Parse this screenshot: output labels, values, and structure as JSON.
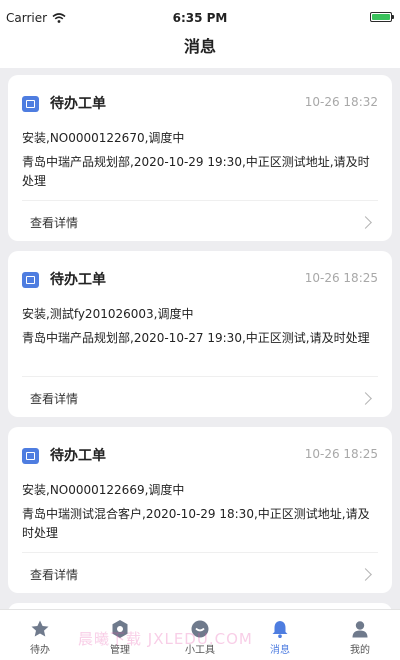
{
  "status_bar": {
    "carrier": "Carrier",
    "time": "6:35 PM"
  },
  "header": {
    "title": "消息"
  },
  "messages": [
    {
      "title": "待办工单",
      "time": "10-26 18:32",
      "line1": "安装,NO0000122670,调度中",
      "line2": "青岛中瑞产品规划部,2020-10-29 19:30,中正区测试地址,请及时处理",
      "action": "查看详情"
    },
    {
      "title": "待办工单",
      "time": "10-26 18:25",
      "line1": "安装,测試fy201026003,调度中",
      "line2": "青岛中瑞产品规划部,2020-10-27 19:30,中正区测试,请及时处理",
      "action": "查看详情"
    },
    {
      "title": "待办工单",
      "time": "10-26 18:25",
      "line1": "安装,NO0000122669,调度中",
      "line2": "青岛中瑞测试混合客户,2020-10-29 18:30,中正区测试地址,请及时处理",
      "action": "查看详情"
    }
  ],
  "tabs": [
    {
      "label": "待办",
      "icon": "star-icon"
    },
    {
      "label": "管理",
      "icon": "gear-icon"
    },
    {
      "label": "小工具",
      "icon": "toolbox-icon"
    },
    {
      "label": "消息",
      "icon": "bell-icon",
      "active": true
    },
    {
      "label": "我的",
      "icon": "user-icon"
    }
  ],
  "watermark": "晨曦下载 JXLEDU.COM",
  "colors": {
    "accent": "#4e7de0",
    "battery": "#39c15b",
    "background": "#ededf0"
  }
}
